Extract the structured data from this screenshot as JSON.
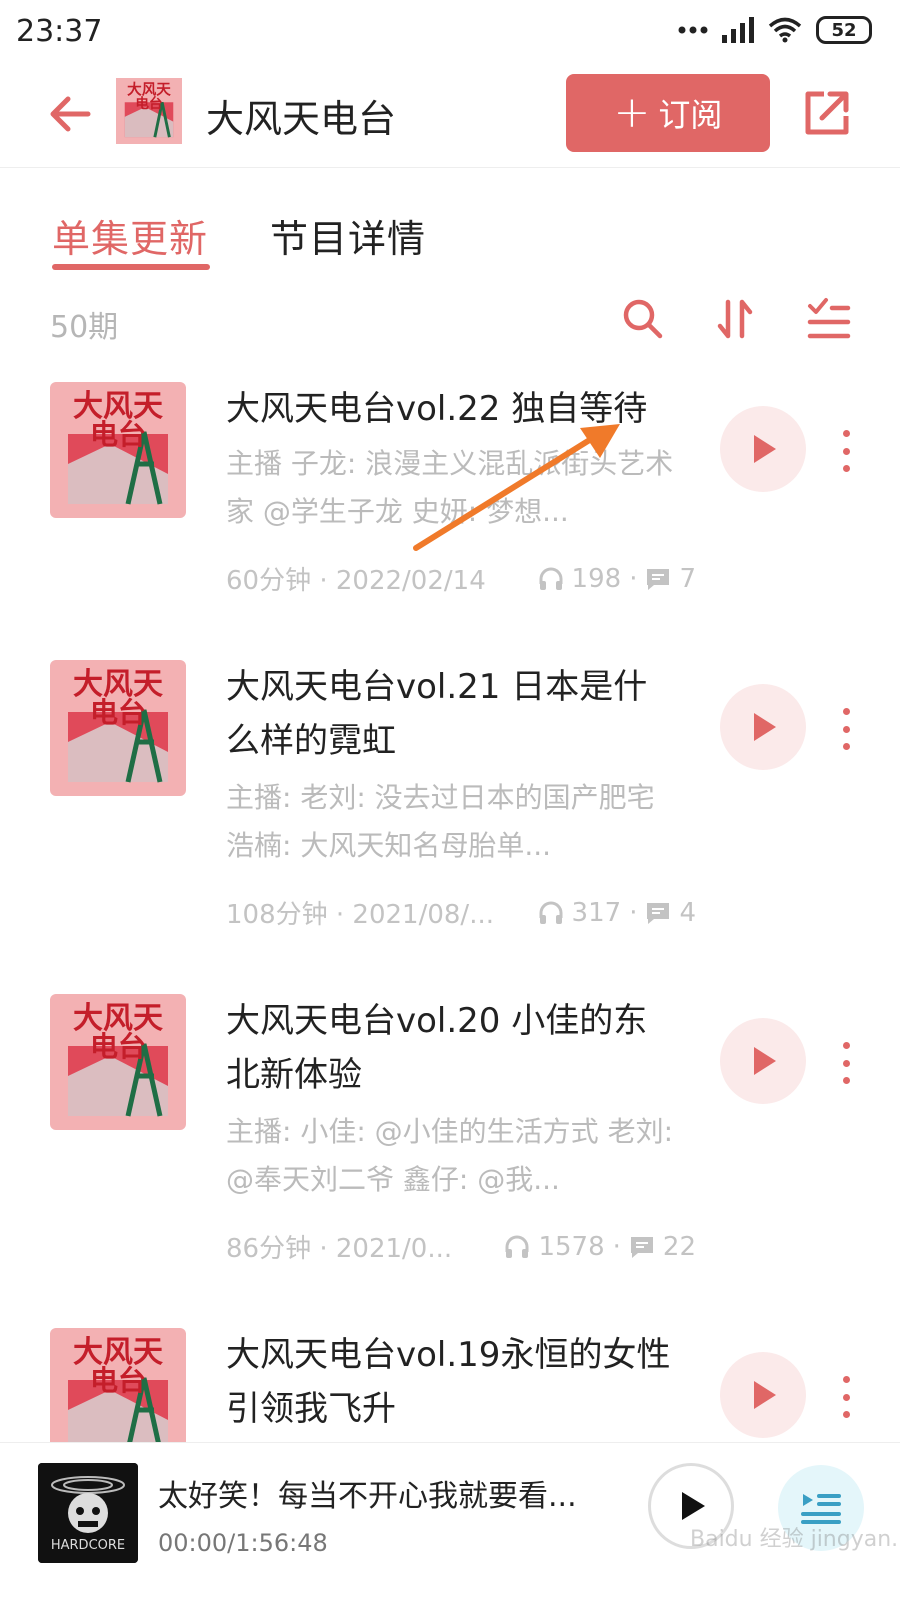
{
  "status_bar": {
    "time": "23:37",
    "battery": "52"
  },
  "header": {
    "title": "大风天电台",
    "subscribe_label": "订阅"
  },
  "tabs": [
    {
      "label": "单集更新"
    },
    {
      "label": "节目详情"
    }
  ],
  "list": {
    "count": "50期",
    "episodes": [
      {
        "title": "大风天电台vol.22 独自等待",
        "description": "主播 子龙: 浪漫主义混乱派街头艺术家 @学生子龙 史妍: 梦想...",
        "duration_date": "60分钟 · 2022/02/14",
        "plays": "198",
        "comments": "7"
      },
      {
        "title": "大风天电台vol.21 日本是什么样的霓虹",
        "description": "主播: 老刘: 没去过日本的国产肥宅 浩楠: 大风天知名母胎单...",
        "duration_date": "108分钟 · 2021/08/...",
        "plays": "317",
        "comments": "4"
      },
      {
        "title": "大风天电台vol.20 小佳的东北新体验",
        "description": "主播: 小佳: @小佳的生活方式 老刘: @奉天刘二爷 鑫仔: @我...",
        "duration_date": "86分钟 · 2021/0...",
        "plays": "1578",
        "comments": "22"
      },
      {
        "title": "大风天电台vol.19永恒的女性引领我飞升",
        "description": "",
        "duration_date": "",
        "plays": "",
        "comments": ""
      }
    ]
  },
  "cover_art": {
    "text_top": "大风天",
    "text_bottom": "电台"
  },
  "player": {
    "title": "太好笑！每当不开心我就要看...",
    "time": "00:00/1:56:48",
    "cover_text": "HARDCORE"
  },
  "watermark": "Baidu 经验 jingyan.baidu.com",
  "colors": {
    "accent": "#e06766",
    "muted": "#bbbbbb",
    "arrow": "#f07a2a"
  }
}
